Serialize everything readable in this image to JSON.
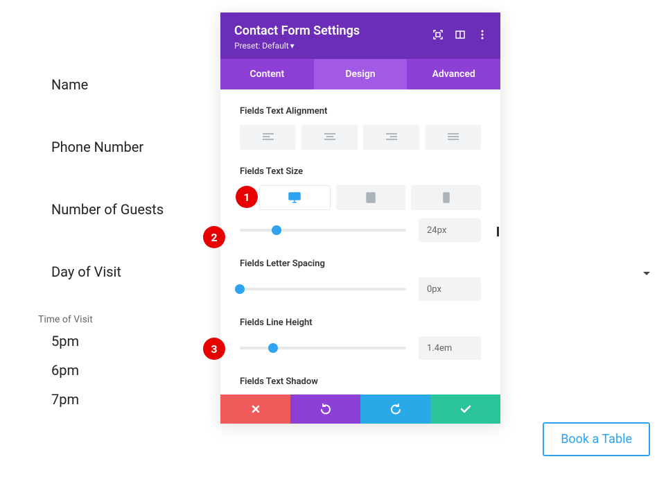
{
  "form": {
    "fields": [
      "Name",
      "Phone Number",
      "Number of Guests",
      "Day of Visit"
    ],
    "time_label": "Time of Visit",
    "times": [
      "5pm",
      "6pm",
      "7pm"
    ]
  },
  "panel": {
    "title": "Contact Form Settings",
    "preset": "Preset: Default",
    "tabs": {
      "content": "Content",
      "design": "Design",
      "advanced": "Advanced"
    },
    "sections": {
      "alignment": "Fields Text Alignment",
      "text_size": "Fields Text Size",
      "letter_spacing": "Fields Letter Spacing",
      "line_height": "Fields Line Height",
      "text_shadow": "Fields Text Shadow"
    },
    "values": {
      "text_size": "24px",
      "letter_spacing": "0px",
      "line_height": "1.4em"
    },
    "slider_pos": {
      "text_size": "22%",
      "letter_spacing": "0%",
      "line_height": "20%"
    }
  },
  "callouts": {
    "c1": "1",
    "c2": "2",
    "c3": "3"
  },
  "book_button": "Book a Table"
}
